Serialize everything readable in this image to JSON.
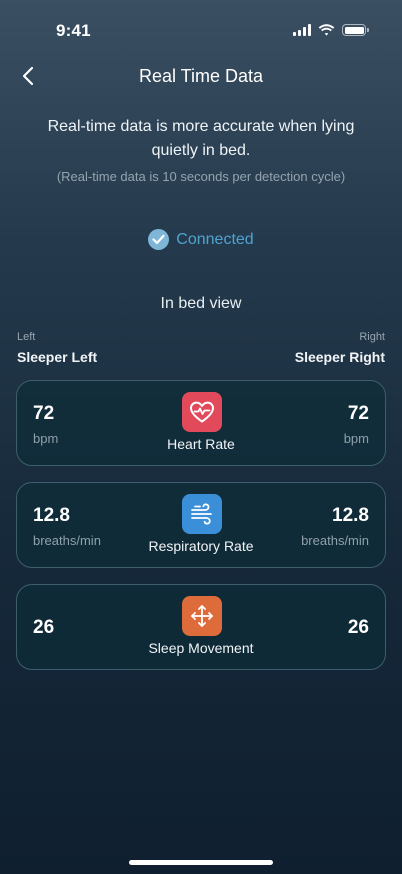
{
  "status_bar": {
    "time": "9:41"
  },
  "nav": {
    "title": "Real Time Data"
  },
  "info": {
    "main": "Real-time data is more accurate when lying quietly in bed.",
    "sub": "(Real-time data is 10 seconds per detection cycle)"
  },
  "connection": {
    "label": "Connected"
  },
  "view": {
    "title": "In bed view",
    "left_label": "Left",
    "right_label": "Right",
    "left_sleeper": "Sleeper Left",
    "right_sleeper": "Sleeper Right"
  },
  "metrics": [
    {
      "name": "Heart Rate",
      "icon": "heart-pulse-icon",
      "left_value": "72",
      "left_unit": "bpm",
      "right_value": "72",
      "right_unit": "bpm"
    },
    {
      "name": "Respiratory Rate",
      "icon": "wind-icon",
      "left_value": "12.8",
      "left_unit": "breaths/min",
      "right_value": "12.8",
      "right_unit": "breaths/min"
    },
    {
      "name": "Sleep Movement",
      "icon": "move-arrows-icon",
      "left_value": "26",
      "right_value": "26"
    }
  ],
  "colors": {
    "accent": "#4fa3cf",
    "heart": "#e24a5c",
    "respiratory": "#3a8fd8",
    "movement": "#de6b3a"
  }
}
